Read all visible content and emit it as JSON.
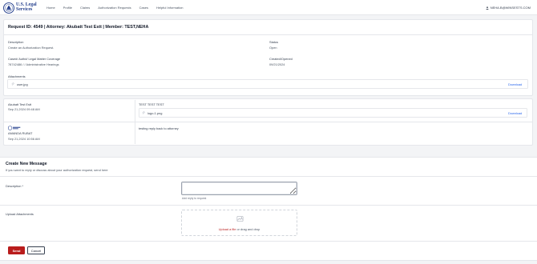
{
  "header": {
    "logo_line1": "U.S. Legal",
    "logo_line2": "Services",
    "nav": [
      "Home",
      "Profile",
      "Claims",
      "Authorization Requests",
      "Cases",
      "Helpful Information"
    ],
    "user_email": "NEHA.B@WINSESTS.COM"
  },
  "request": {
    "title": "Request ID: 4549 | Attorney: Akubatt Test Estt | Member: TEST,NEHA",
    "description_label": "Description",
    "description_value": "Create an Authorization Request.",
    "status_label": "Status",
    "status_value": "Open",
    "coverage_label": "Case#/ Auth#/ Legal Matter Coverage",
    "coverage_value": "78742486 / / Administrative Hearings",
    "created_label": "Created/Opened",
    "created_value": "09/21/2024",
    "attachments_label": "Attachments",
    "attachment_name": "user.jpg",
    "download_label": "Download"
  },
  "messages": [
    {
      "author": "Akubatt Test Estt",
      "date": "Sep 21,2024 09:48 AM",
      "body": "TEST TEST TEST",
      "attachment": "logo-1.png",
      "download_label": "Download"
    },
    {
      "author": "AMANDA RUBAT",
      "date": "Sep 21,2024 10:56 AM",
      "body": "testing reply back to attorney"
    }
  ],
  "new_message": {
    "title": "Create New Message",
    "subtitle": "If you want to reply or discuss about your authorization request, send here",
    "description_label": "Description *",
    "description_value": "",
    "hint": "Add reply to request",
    "upload_label": "Upload Attachments",
    "upload_link": "Upload a file",
    "upload_rest": " or drag and drop",
    "send_label": "Send",
    "cancel_label": "Cancel"
  },
  "colors": {
    "brand_blue": "#1e3a8a",
    "accent_red": "#b91c1c",
    "link_blue": "#2563eb"
  }
}
